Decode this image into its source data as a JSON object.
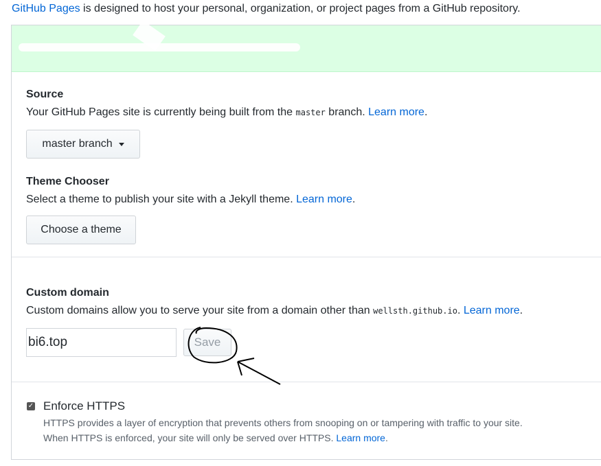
{
  "intro": {
    "link": "GitHub Pages",
    "text": " is designed to host your personal, organization, or project pages from a GitHub repository."
  },
  "source": {
    "heading": "Source",
    "text_before": "Your GitHub Pages site is currently being built from the ",
    "branch_code": "master",
    "text_after": " branch. ",
    "learn_more": "Learn more",
    "period": ".",
    "button_label": "master branch"
  },
  "theme": {
    "heading": "Theme Chooser",
    "text": "Select a theme to publish your site with a Jekyll theme. ",
    "learn_more": "Learn more",
    "period": ".",
    "button_label": "Choose a theme"
  },
  "custom_domain": {
    "heading": "Custom domain",
    "text_before": "Custom domains allow you to serve your site from a domain other than ",
    "domain_code": "wellsth.github.io",
    "text_after": ". ",
    "learn_more": "Learn more",
    "period": ".",
    "input_value": "bi6.top",
    "save_label": "Save"
  },
  "https": {
    "label": "Enforce HTTPS",
    "checked": true,
    "desc_line1": "HTTPS provides a layer of encryption that prevents others from snooping on or tampering with traffic to your site.",
    "desc_line2": "When HTTPS is enforced, your site will only be served over HTTPS. ",
    "learn_more": "Learn more",
    "period": "."
  },
  "colors": {
    "link": "#0366d6",
    "flash_bg": "#dcffe4",
    "text": "#24292e",
    "muted": "#586069"
  }
}
